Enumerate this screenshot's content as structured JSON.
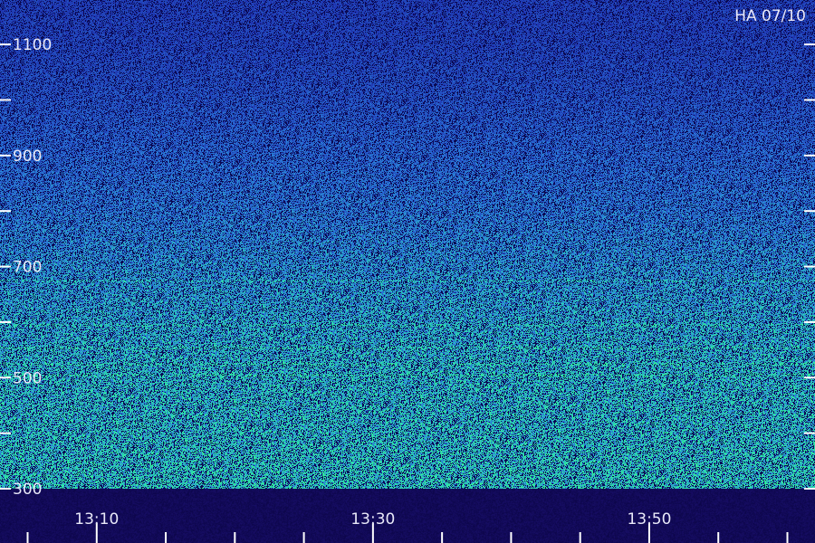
{
  "station_label": "HA 07/10",
  "colors": {
    "background": "#0a0a40",
    "band": "#120a58",
    "low": "#1a1aa0",
    "mid": "#2a7ad8",
    "high": "#2ad8b0",
    "peak": "#3aff80",
    "tick": "#ffffff",
    "text": "#e8e8f8"
  },
  "chart_data": {
    "type": "heatmap",
    "title": "HA 07/10",
    "xlabel": "",
    "ylabel": "",
    "x_ticks": [
      "13:10",
      "13:30",
      "13:50"
    ],
    "x_tick_values_min": [
      790,
      810,
      830
    ],
    "x_range_min": [
      783,
      842
    ],
    "x_minor_step_min": 5,
    "y_ticks": [
      1100,
      900,
      700,
      500,
      300
    ],
    "y_range": [
      300,
      1180
    ],
    "y_minor_step": 100,
    "colormap": [
      "#1a1aa0",
      "#2a7ad8",
      "#2ad8b0",
      "#3aff80"
    ],
    "intensity_profile": [
      {
        "freq": 300,
        "intensity": 0.78
      },
      {
        "freq": 400,
        "intensity": 0.72
      },
      {
        "freq": 500,
        "intensity": 0.7
      },
      {
        "freq": 600,
        "intensity": 0.62
      },
      {
        "freq": 700,
        "intensity": 0.52
      },
      {
        "freq": 800,
        "intensity": 0.4
      },
      {
        "freq": 900,
        "intensity": 0.32
      },
      {
        "freq": 1000,
        "intensity": 0.24
      },
      {
        "freq": 1100,
        "intensity": 0.18
      },
      {
        "freq": 1180,
        "intensity": 0.16
      }
    ],
    "bright_lines_freq": [
      505,
      525,
      555,
      595,
      675
    ],
    "grid": false,
    "legend": "none"
  }
}
